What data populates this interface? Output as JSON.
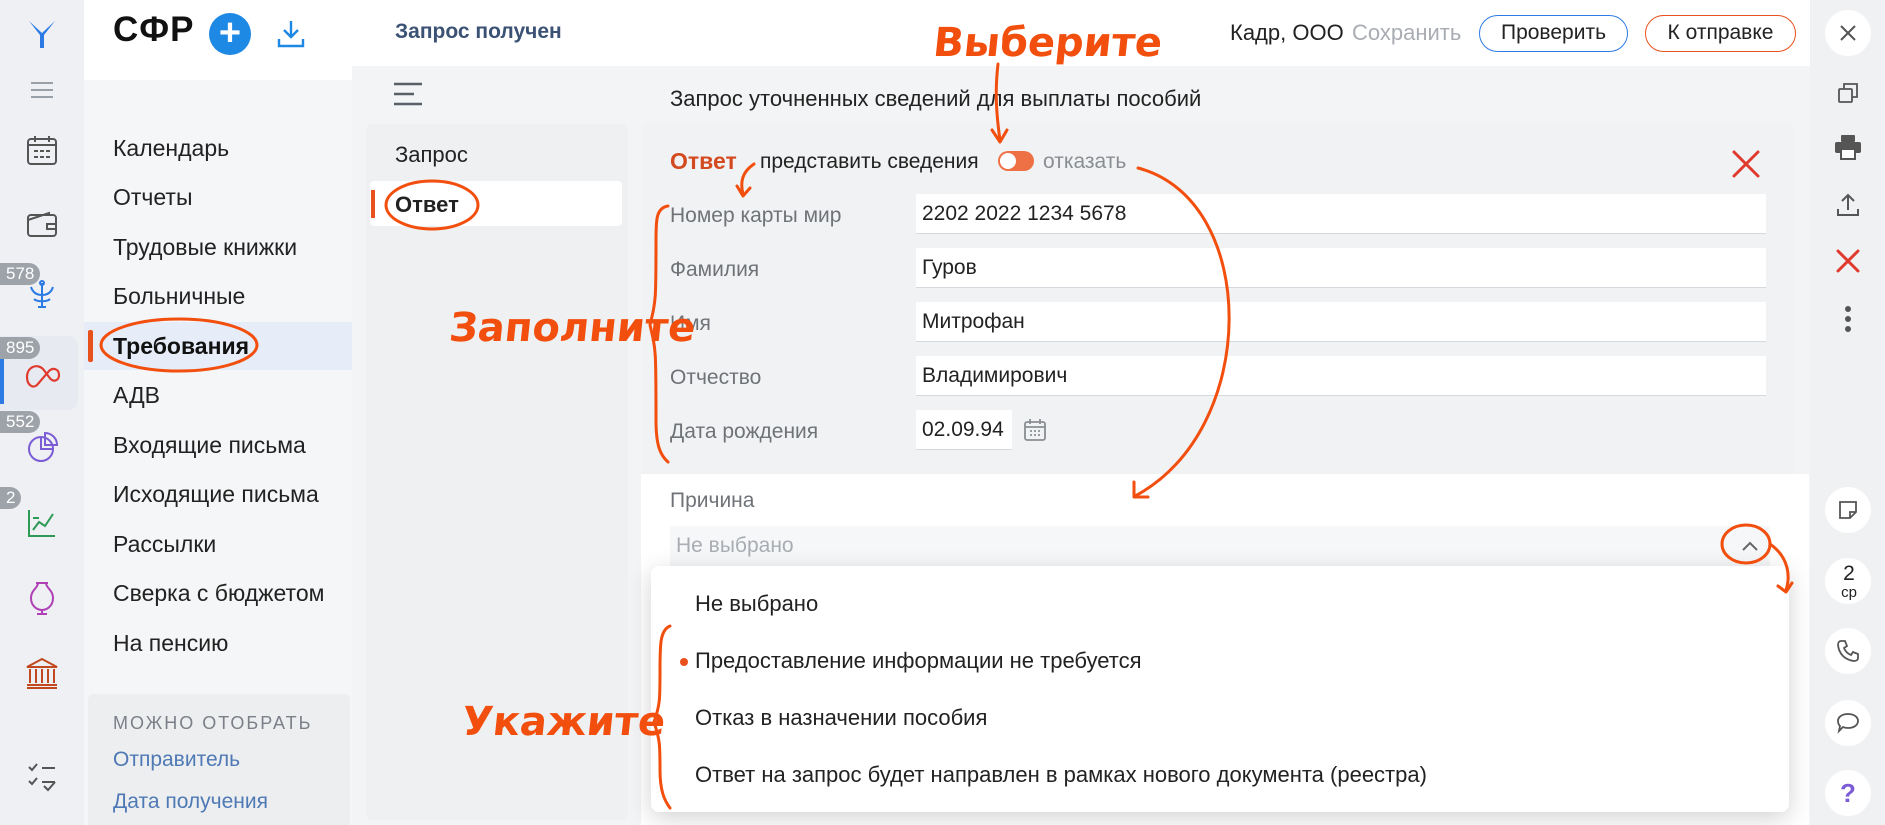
{
  "app": {
    "title": "СФР",
    "add_label": "+",
    "rail_badges": [
      "578",
      "895",
      "552",
      "2"
    ]
  },
  "nav": {
    "items": [
      "Календарь",
      "Отчеты",
      "Трудовые книжки",
      "Больничные",
      "Требования",
      "АДВ",
      "Входящие письма",
      "Исходящие письма",
      "Рассылки",
      "Сверка с бюджетом",
      "На пенсию"
    ],
    "active_index": 4,
    "filter_title": "МОЖНО ОТОБРАТЬ",
    "filters": [
      "Отправитель",
      "Дата получения"
    ]
  },
  "doc": {
    "status": "Запрос получен",
    "company": "Кадр, ООО",
    "save_label": "Сохранить",
    "check_label": "Проверить",
    "send_label": "К отправке",
    "title": "Запрос уточненных сведений для выплаты пособий",
    "sections": [
      "Запрос",
      "Ответ"
    ]
  },
  "form": {
    "answer_label": "Ответ",
    "provide_label": "представить сведения",
    "refuse_label": "отказать",
    "fields": [
      {
        "label": "Номер карты мир",
        "value": "2202 2022 1234 5678"
      },
      {
        "label": "Фамилия",
        "value": "Гуров"
      },
      {
        "label": "Имя",
        "value": "Митрофан"
      },
      {
        "label": "Отчество",
        "value": "Владимирович"
      },
      {
        "label": "Дата рождения",
        "value": "02.09.94"
      }
    ],
    "reason_label": "Причина",
    "reason_value": "Не выбрано",
    "reason_options": [
      "Не выбрано",
      "Предоставление информации не требуется",
      "Отказ в назначении пособия",
      "Ответ на запрос будет направлен в рамках нового документа (реестра)"
    ]
  },
  "right_rail": {
    "day_number": "2",
    "day_name": "ср",
    "help_label": "?"
  },
  "annotations": {
    "choose": "Выберите",
    "fill": "Заполните",
    "specify": "Укажите"
  },
  "colors": {
    "accent": "#e8501c",
    "primary": "#2c7be5",
    "annotation": "#f24e0e"
  }
}
